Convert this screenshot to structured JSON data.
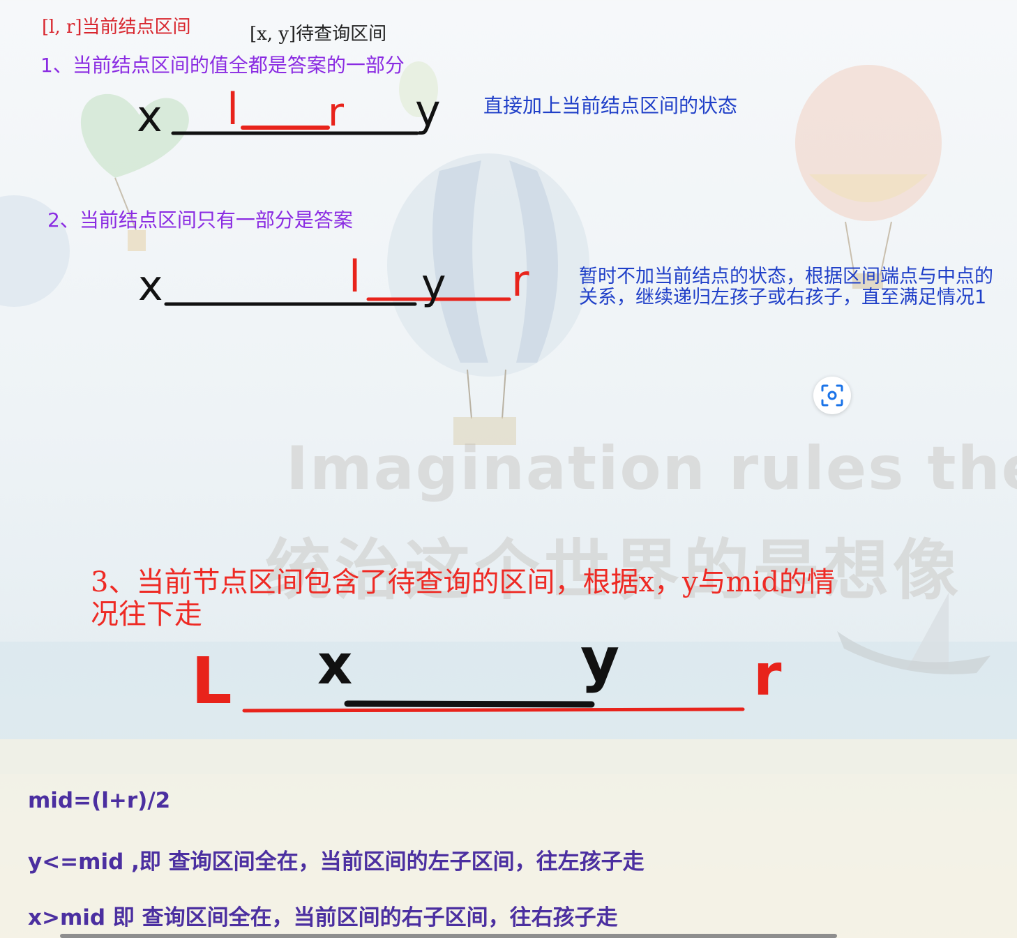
{
  "header": {
    "node_interval": "[l, r]当前结点区间",
    "query_interval": "[x, y]待查询区间"
  },
  "case1": {
    "title": "1、当前结点区间的值全都是答案的一部分",
    "note": "直接加上当前结点区间的状态",
    "labels": {
      "x": "x",
      "l": "l",
      "r": "r",
      "y": "y"
    }
  },
  "case2": {
    "title": "2、当前结点区间只有一部分是答案",
    "note": "暂时不加当前结点的状态，根据区间端点与中点的关系，继续递归左孩子或右孩子，直至满足情况1",
    "labels": {
      "x": "x",
      "l": "l",
      "y": "y",
      "r": "r"
    }
  },
  "case3": {
    "title": "3、当前节点区间包含了待查询的区间，根据x，y与mid的情况往下走",
    "labels": {
      "l": "L",
      "x": "x",
      "y": "y",
      "r": "r"
    }
  },
  "watermark": {
    "english": "Imagination rules the",
    "chinese": "统治这个世界的是想像"
  },
  "formulas": {
    "mid": "mid=(l+r)/2",
    "left_rule": "y<=mid ,即 查询区间全在，当前区间的左子区间，往左孩子走",
    "right_rule": "x>mid 即 查询区间全在，当前区间的右子区间，往右孩子走"
  },
  "colors": {
    "red": "#e8231b",
    "black": "#111111",
    "purple": "#8a2be2",
    "blue": "#1f3fc8"
  },
  "icons": [
    "lens-icon"
  ]
}
